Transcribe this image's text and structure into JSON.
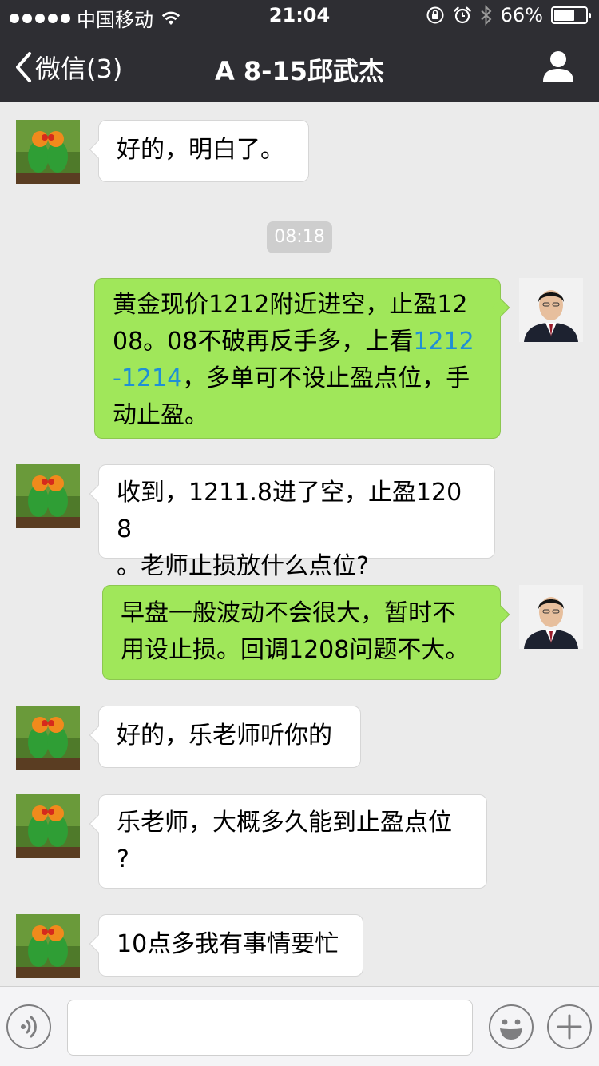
{
  "status_bar": {
    "carrier": "中国移动",
    "time": "21:04",
    "battery_percent": "66%",
    "battery_level": 0.66
  },
  "nav": {
    "back_label": "微信(3)",
    "title": "A  8-15邱武杰"
  },
  "messages": [
    {
      "side": "left",
      "avatar": "parrots-avatar",
      "text": "好的，明白了。"
    },
    {
      "timestamp": "08:18"
    },
    {
      "side": "right",
      "avatar": "man-in-suit-avatar",
      "text_before_link": "黄金现价1212附近进空，止盈1208。08不破再反手多，上看",
      "link": "1212-1214",
      "text_after_link": "，多单可不设止盈点位，手动止盈。"
    },
    {
      "side": "left",
      "avatar": "parrots-avatar",
      "text": "收到，1211.8进了空，止盈1208。老师止损放什么点位?"
    },
    {
      "side": "right",
      "avatar": "man-in-suit-avatar",
      "text": "早盘一般波动不会很大，暂时不用设止损。回调1208问题不大。"
    },
    {
      "side": "left",
      "avatar": "parrots-avatar",
      "text": "好的，乐老师听你的"
    },
    {
      "side": "left",
      "avatar": "parrots-avatar",
      "text": "乐老师，大概多久能到止盈点位?"
    },
    {
      "side": "left",
      "avatar": "parrots-avatar",
      "text": "10点多我有事情要忙"
    }
  ],
  "m0": "好的，明白了。",
  "ts": "08:18",
  "m2a": "黄金现价1212附近进空，止盈12",
  "m2b": "08。08不破再反手多，上看",
  "m2link1": "1212",
  "m2link2": "-1214",
  "m2c": "，多单可不设止盈点位，手",
  "m2d": "动止盈。",
  "m3a": "收到，1211.8进了空，止盈1208",
  "m3b": "。老师止损放什么点位?",
  "m4a": "早盘一般波动不会很大，暂时不",
  "m4b": "用设止损。回调1208问题不大。",
  "m5": "好的，乐老师听你的",
  "m6a": "乐老师，大概多久能到止盈点位",
  "m6b": "?",
  "m7": "10点多我有事情要忙",
  "input_bar": {
    "text_value": "",
    "icons": [
      "voice-icon",
      "emoji-icon",
      "plus-icon"
    ]
  },
  "colors": {
    "topbar": "#2e2e33",
    "sent_bubble": "#a0e75a",
    "received_bubble": "#ffffff",
    "chat_background": "#ebebeb",
    "link": "#1f8fd6"
  }
}
